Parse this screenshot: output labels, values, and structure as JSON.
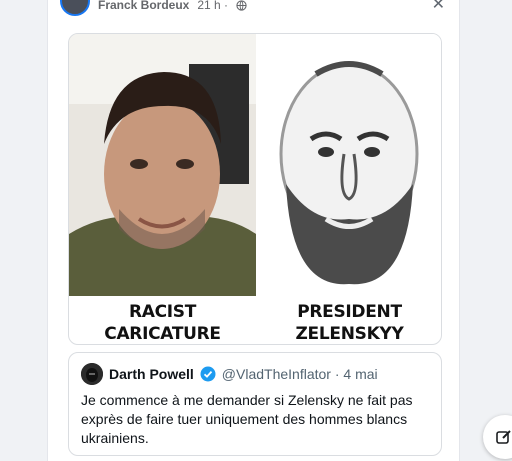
{
  "post": {
    "author": "Franck Bordeux",
    "time": "21 h ·",
    "privacy_icon": "globe-icon",
    "close_icon": "close-icon"
  },
  "image": {
    "left_caption": "RACIST\nCARICATURE",
    "right_caption": "PRESIDENT\nZELENSKYY"
  },
  "tweet": {
    "name": "Darth Powell",
    "handle": "@VladTheInflator · 4 mai",
    "text": "Je commence à me demander si Zelensky ne fait pas exprès de faire tuer uniquement des hommes blancs ukrainiens.",
    "verified_color": "#1d9bf0"
  },
  "fab": {
    "icon": "compose-icon"
  },
  "colors": {
    "page_bg": "#f0f2f5",
    "accent": "#1877f2"
  }
}
